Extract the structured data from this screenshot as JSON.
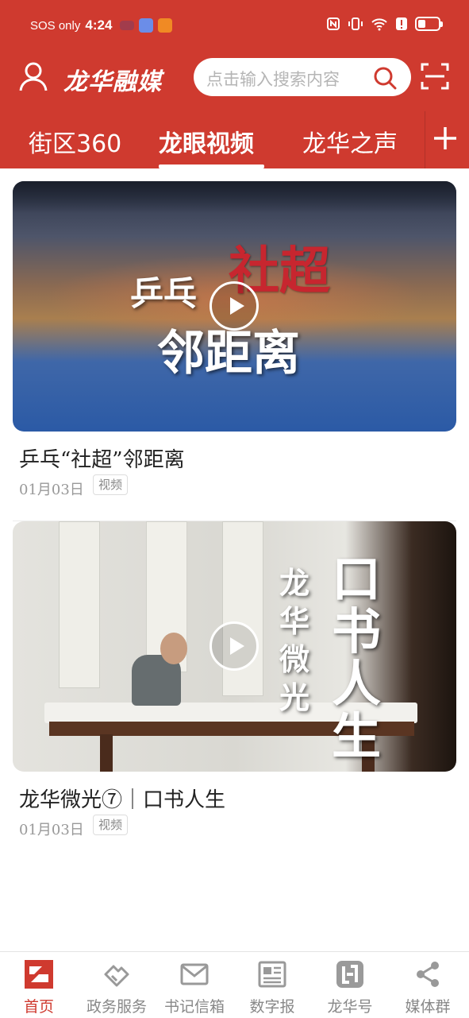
{
  "status_bar": {
    "carrier": "SOS only",
    "time": "4:24"
  },
  "header": {
    "brand": "龙华融媒",
    "search_placeholder": "点击输入搜索内容"
  },
  "tabs": [
    {
      "label": "街区360"
    },
    {
      "label": "龙眼视频"
    },
    {
      "label": "龙华之声"
    }
  ],
  "feed": [
    {
      "title": "乒乓“社超”邻距离",
      "date": "01月03日",
      "badge": "视频",
      "thumb_text": {
        "a": "乒乓",
        "b": "社超",
        "c": "邻距离"
      }
    },
    {
      "title": "龙华微光⑦｜口书人生",
      "date": "01月03日",
      "badge": "视频",
      "thumb_text": {
        "a": "龙华微光",
        "b": "口书人生"
      }
    }
  ],
  "bottom_nav": [
    {
      "label": "首页",
      "icon": "home-logo-icon"
    },
    {
      "label": "政务服务",
      "icon": "handshake-icon"
    },
    {
      "label": "书记信箱",
      "icon": "mail-icon"
    },
    {
      "label": "数字报",
      "icon": "newspaper-icon"
    },
    {
      "label": "龙华号",
      "icon": "longhua-logo-icon"
    },
    {
      "label": "媒体群",
      "icon": "share-icon"
    }
  ],
  "colors": {
    "brand_red": "#cf3a2f",
    "nav_inactive": "#888888"
  }
}
